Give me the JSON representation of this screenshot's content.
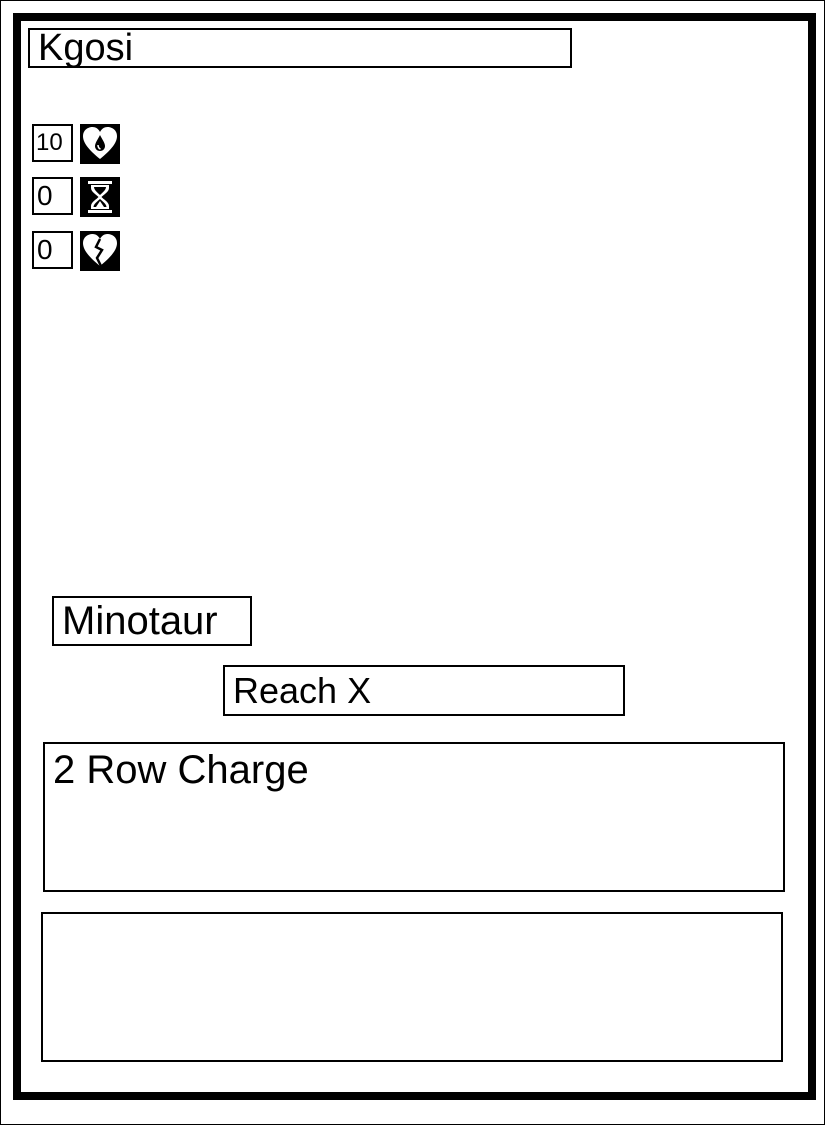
{
  "card": {
    "name": "Kgosi",
    "stats": [
      {
        "value": "10",
        "icon": "heart-drop-icon"
      },
      {
        "value": "0",
        "icon": "hourglass-icon"
      },
      {
        "value": "0",
        "icon": "broken-heart-icon"
      }
    ],
    "type": "Minotaur",
    "keyword": "Reach X",
    "ability": "2 Row Charge",
    "flavor": ""
  }
}
